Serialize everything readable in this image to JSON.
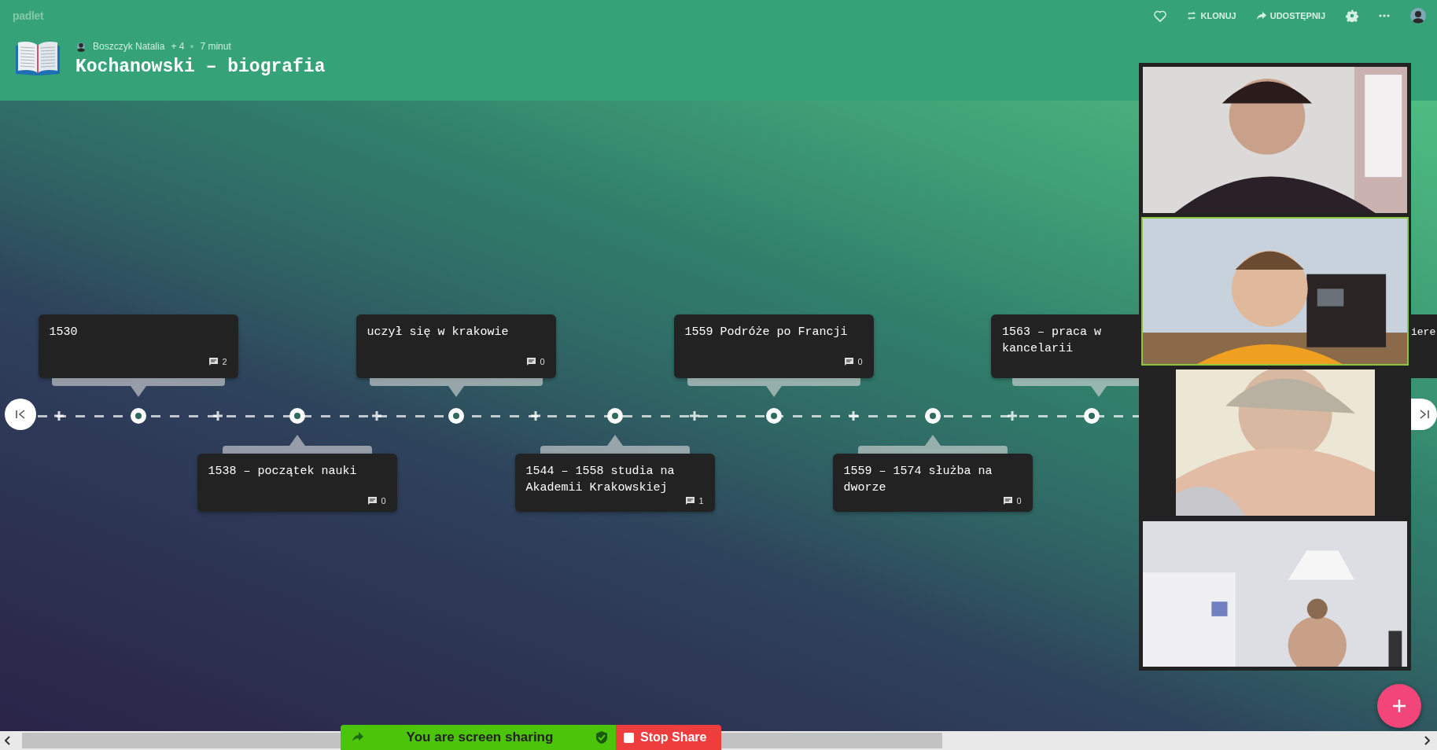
{
  "app": {
    "logo": "padlet"
  },
  "header": {
    "author": "Boszczyk Natalia",
    "collaborators": "+ 4",
    "time": "7 minut",
    "title": "Kochanowski – biografia"
  },
  "actions": [
    {
      "kind": "heart"
    },
    {
      "kind": "clone",
      "label": "KLONUJ"
    },
    {
      "kind": "share",
      "label": "UDOSTĘPNIJ"
    },
    {
      "kind": "settings"
    },
    {
      "kind": "more"
    },
    {
      "kind": "avatar"
    }
  ],
  "timeline": {
    "items": [
      {
        "kind": "above",
        "text": "1530",
        "comments": "2"
      },
      {
        "kind": "below",
        "text": "1538 – początek nauki",
        "comments": "0"
      },
      {
        "kind": "above",
        "text": "uczył się w krakowie",
        "comments": "0"
      },
      {
        "kind": "below",
        "text": "1544 – 1558 studia na Akademii Krakowskiej",
        "comments": "1"
      },
      {
        "kind": "above",
        "text": "1559 Podróże po Francji",
        "comments": "0"
      },
      {
        "kind": "below",
        "text": "1559 – 1574 służba na dworze",
        "comments": "0"
      },
      {
        "kind": "above_cut",
        "text": "1563 – praca w kancelarii"
      }
    ],
    "partial_text": "iere"
  },
  "video_tiles": [
    {
      "kind": "picture",
      "active": false
    },
    {
      "kind": "picture",
      "active": true
    },
    {
      "kind": "picture",
      "active": false
    },
    {
      "kind": "picture",
      "active": false
    }
  ],
  "screen_share": {
    "status": "You are screen sharing",
    "stop": "Stop Share"
  }
}
